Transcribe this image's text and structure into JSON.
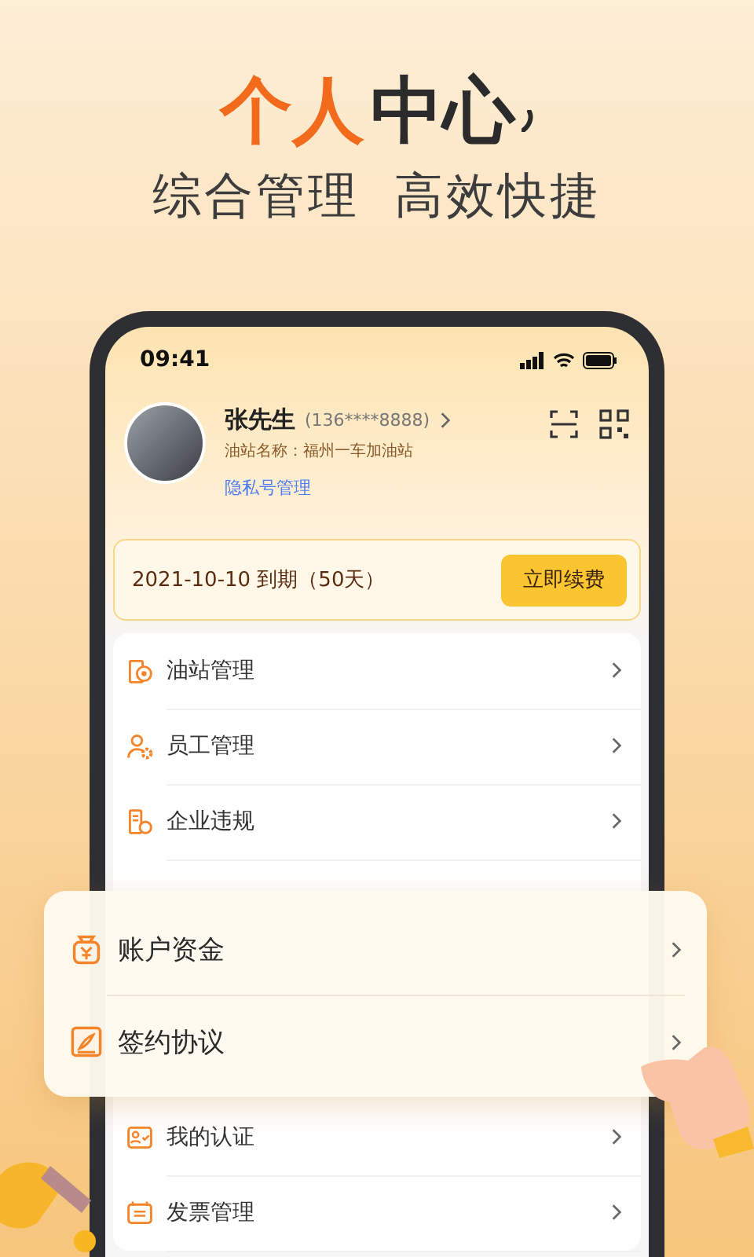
{
  "headline": {
    "accent": "个人",
    "main": "中心"
  },
  "subtitle": "综合管理 高效快捷",
  "status_bar": {
    "time": "09:41"
  },
  "profile": {
    "name": "张先生",
    "phone": "(136****8888)",
    "station": "油站名称：福州一车加油站",
    "privacy_link": "隐私号管理"
  },
  "membership": {
    "expiry": "2021-10-10 到期（50天）",
    "renew_button": "立即续费"
  },
  "menu": [
    {
      "label": "油站管理",
      "kind": "station"
    },
    {
      "label": "员工管理",
      "kind": "staff"
    },
    {
      "label": "企业违规",
      "kind": "violation"
    }
  ],
  "menu_lower": [
    {
      "label": "我的认证",
      "kind": "certification"
    },
    {
      "label": "发票管理",
      "kind": "invoice"
    }
  ],
  "featured_menu": [
    {
      "label": "账户资金",
      "kind": "wallet"
    },
    {
      "label": "签约协议",
      "kind": "contract"
    }
  ]
}
